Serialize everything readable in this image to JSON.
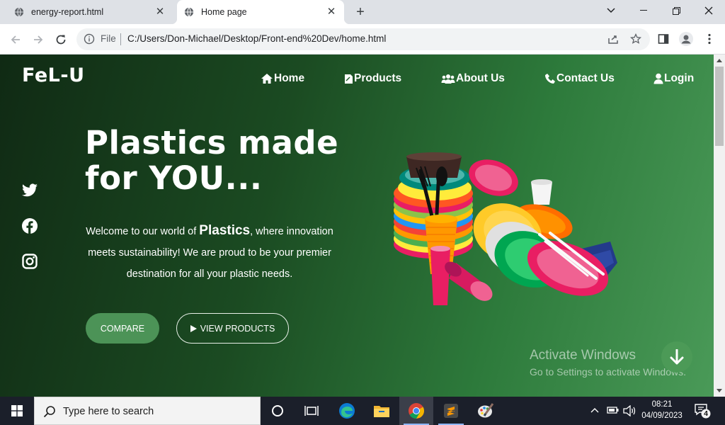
{
  "browser": {
    "tabs": [
      {
        "title": "energy-report.html",
        "active": false
      },
      {
        "title": "Home page",
        "active": true
      }
    ],
    "url_scheme_label": "File",
    "url": "C:/Users/Don-Michael/Desktop/Front-end%20Dev/home.html"
  },
  "site": {
    "brand": "FeL-U",
    "nav": [
      {
        "label": "Home",
        "icon": "home-icon"
      },
      {
        "label": "Products",
        "icon": "products-icon"
      },
      {
        "label": "About Us",
        "icon": "users-icon"
      },
      {
        "label": "Contact Us",
        "icon": "phone-icon"
      },
      {
        "label": "Login",
        "icon": "user-icon"
      }
    ],
    "social": [
      "twitter-icon",
      "facebook-icon",
      "instagram-icon"
    ],
    "hero": {
      "title_line1": "Plastics made",
      "title_line2": "for YOU...",
      "text_before": "Welcome to our world of ",
      "text_highlight": "Plastics",
      "text_after": ", where innovation meets sustainability! We are proud to be your premier destination for all your plastic needs."
    },
    "buttons": {
      "compare": "COMPARE",
      "view_products": "VIEW PRODUCTS"
    },
    "watermark": {
      "line1": "Activate Windows",
      "line2": "Go to Settings to activate Windows."
    }
  },
  "taskbar": {
    "search_placeholder": "Type here to search",
    "time": "08:21",
    "date": "04/09/2023",
    "notification_count": "4"
  },
  "colors": {
    "accent_green": "#4c9357",
    "page_dark": "#102a14",
    "page_light": "#4a9a58"
  }
}
